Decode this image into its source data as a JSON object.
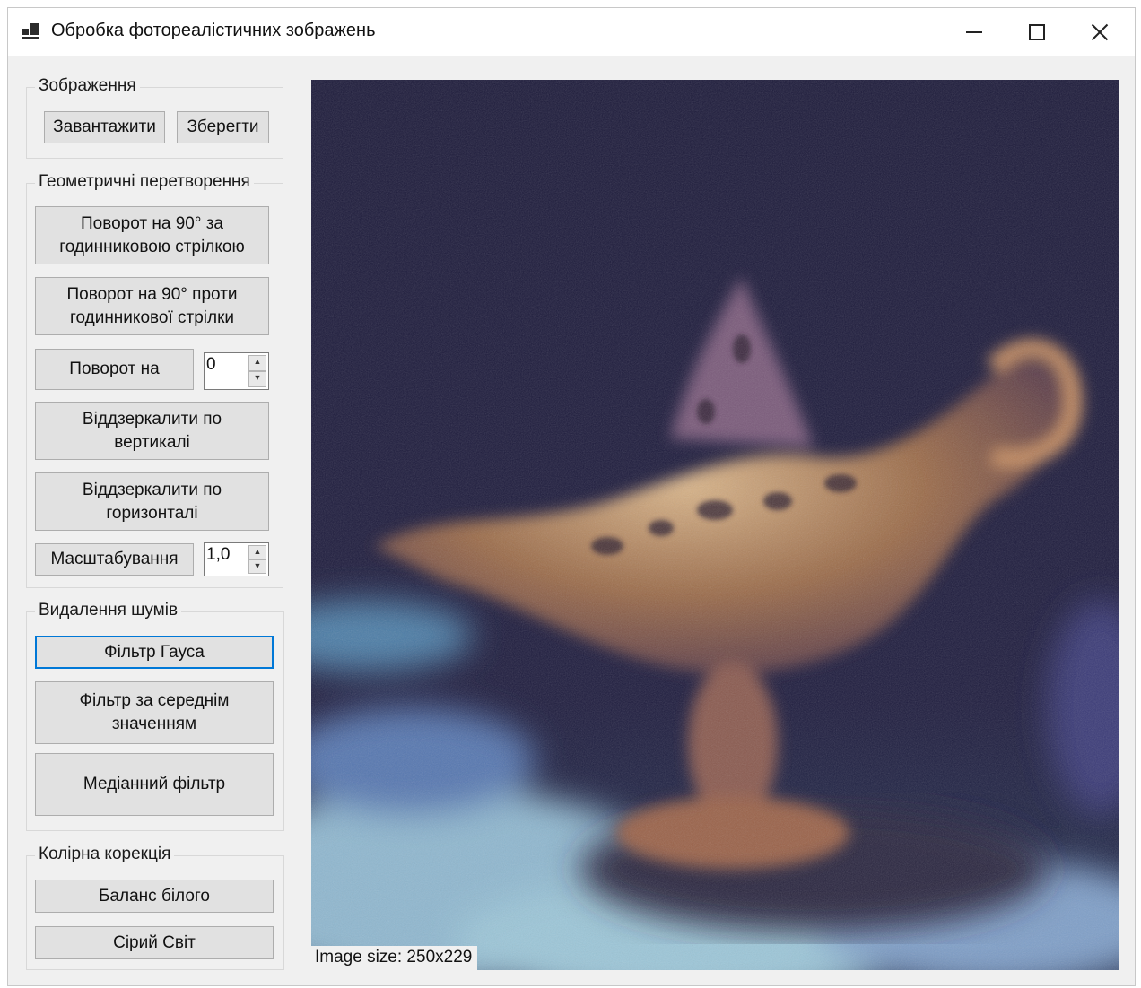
{
  "window": {
    "title": "Обробка фотореалістичних зображень",
    "icon": "app-window-icon",
    "controls": {
      "minimize": "minimize-icon",
      "maximize": "maximize-icon",
      "close": "close-icon"
    }
  },
  "image_group": {
    "title": "Зображення",
    "load_label": "Завантажити",
    "save_label": "Зберегти"
  },
  "geometry_group": {
    "title": "Геометричні перетворення",
    "rotate_cw_label": "Поворот на 90° за\nгодинниковою стрілкою",
    "rotate_ccw_label": "Поворот на 90° проти\nгодинникової стрілки",
    "rotate_by_label": "Поворот на",
    "rotate_value": "0",
    "flip_vertical_label": "Віддзеркалити по\nвертикалі",
    "flip_horizontal_label": "Віддзеркалити по\nгоризонталі",
    "scale_label": "Масштабування",
    "scale_value": "1,0"
  },
  "noise_group": {
    "title": "Видалення шумів",
    "gauss_label": "Фільтр Гауса",
    "mean_label": "Фільтр за середнім\nзначенням",
    "median_label": "Медіанний фільтр"
  },
  "color_group": {
    "title": "Колірна корекція",
    "white_balance_label": "Баланс білого",
    "gray_world_label": "Сірий Світ"
  },
  "image_view": {
    "size_text": "Image size: 250x229",
    "subject": "magic-lamp-photo",
    "colors": {
      "background": "#1c1a3a",
      "lamp": "#9a6a48",
      "highlight": "#d9b58a",
      "cloud": "#8fb7cf",
      "shadow": "#2a2540"
    }
  }
}
